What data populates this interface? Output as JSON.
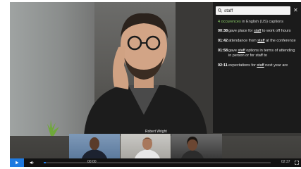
{
  "video": {
    "speaker_name": "Robert Wright",
    "progress_fraction": 0.01
  },
  "search": {
    "value": "staff",
    "summary_count": "4 occurences",
    "summary_rest": " in English (US) captions"
  },
  "results": [
    {
      "time": "00:38",
      "before": "gave place for ",
      "match": "staff",
      "after": " to work off hours"
    },
    {
      "time": "01:42",
      "before": "attendance from ",
      "match": "staff",
      "after": " at the conference"
    },
    {
      "time": "01:58",
      "before": "gave ",
      "match": "staff",
      "after": " options in terms of attending in person or for staff to"
    },
    {
      "time": "02:11",
      "before": "expectations for ",
      "match": "staff",
      "after": " next year are"
    }
  ],
  "controls": {
    "current_time": "00:00",
    "total_time": "02:37"
  },
  "colors": {
    "accent": "#1f7ae0",
    "summary_count": "#8fd36a"
  },
  "icons": [
    "search-icon",
    "close-icon",
    "play-icon",
    "volume-icon",
    "fullscreen-icon"
  ]
}
